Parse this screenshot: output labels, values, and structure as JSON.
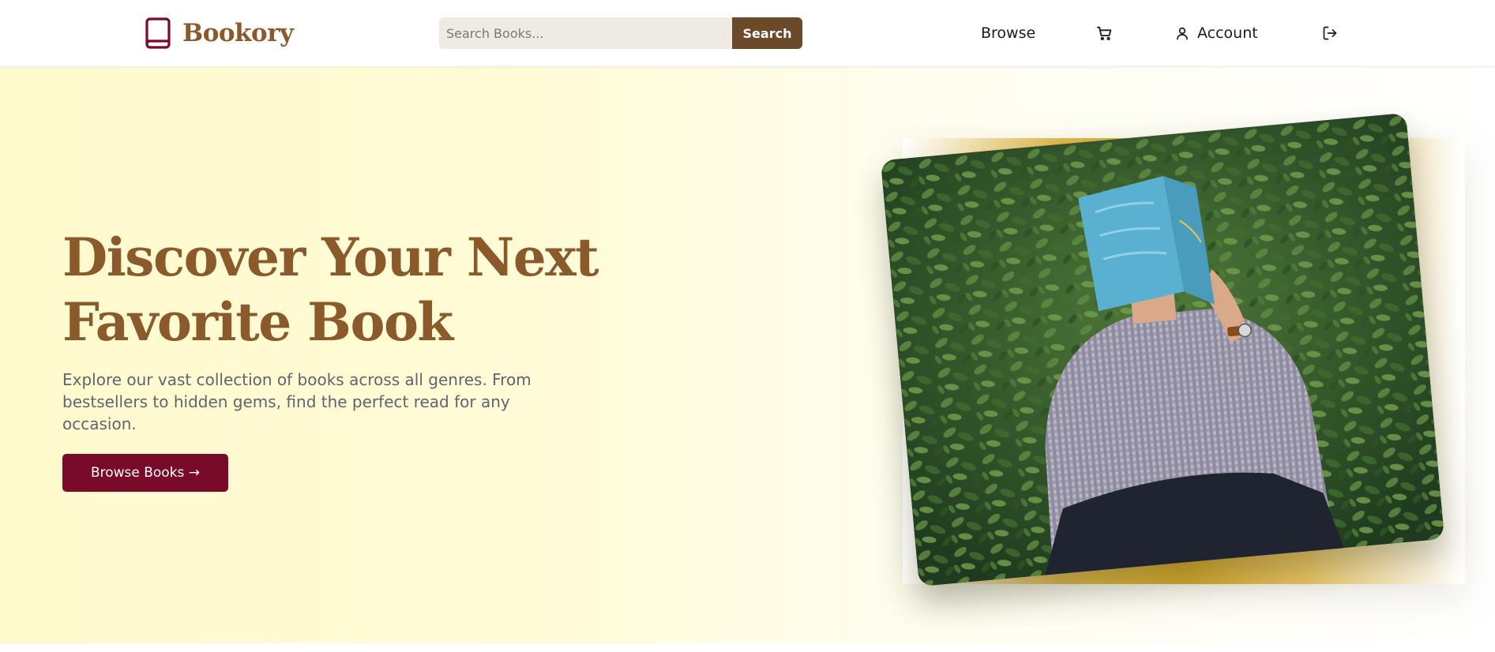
{
  "brand": {
    "name": "Bookory",
    "color": "#8b5a2b",
    "icon_color": "#7a0a2a",
    "icon": "book-icon"
  },
  "search": {
    "placeholder": "Search Books...",
    "value": "",
    "button_label": "Search"
  },
  "nav": {
    "browse_label": "Browse",
    "cart_icon": "cart-icon",
    "account_label": "Account",
    "account_icon": "user-icon",
    "logout_icon": "logout-icon"
  },
  "hero": {
    "title_line1": "Discover Your Next",
    "title_line2": "Favorite Book",
    "description": "Explore our vast collection of books across all genres. From bestsellers to hidden gems, find the perfect read for any occasion.",
    "button_label": "Browse Books →",
    "image_alt": "Person reading a blue book in front of green foliage"
  },
  "colors": {
    "accent_button": "#7a0a2a",
    "search_button": "#6b4a2a",
    "hero_bg": "#fffacd",
    "photo_accent": "#d4a62a"
  }
}
